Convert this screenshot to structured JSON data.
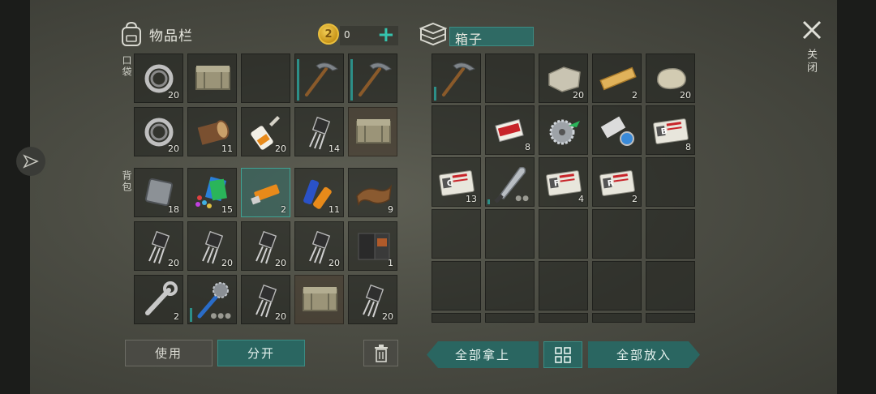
{
  "inventory": {
    "title": "物品栏",
    "coin_icon_label": "2",
    "coins": "0",
    "add_coins": "+",
    "pockets_label": "口袋",
    "backpack_label": "背包"
  },
  "container": {
    "title": "箱子"
  },
  "pocket_slots": [
    {
      "icon": "bearing-icon",
      "count": "20"
    },
    {
      "icon": "crate-icon",
      "count": ""
    },
    {
      "icon": "empty",
      "count": ""
    },
    {
      "icon": "pickaxe-icon",
      "count": "",
      "durability": 0.9
    },
    {
      "icon": "pickaxe-icon",
      "count": "",
      "durability": 0.9
    },
    {
      "icon": "bearing-icon",
      "count": "20"
    },
    {
      "icon": "log-icon",
      "count": "11"
    },
    {
      "icon": "glue-icon",
      "count": "20"
    },
    {
      "icon": "transistor-icon",
      "count": "14"
    },
    {
      "icon": "crate-icon",
      "count": ""
    }
  ],
  "backpack_slots": [
    {
      "icon": "metal-plate-icon",
      "count": "18"
    },
    {
      "icon": "circuit-parts-icon",
      "count": "15"
    },
    {
      "icon": "usb-drive-icon",
      "count": "2",
      "selected": true
    },
    {
      "icon": "batteries-icon",
      "count": "11"
    },
    {
      "icon": "leather-icon",
      "count": "9"
    },
    {
      "icon": "transistor-icon",
      "count": "20"
    },
    {
      "icon": "transistor-icon",
      "count": "20"
    },
    {
      "icon": "transistor-icon",
      "count": "20"
    },
    {
      "icon": "transistor-icon",
      "count": "20"
    },
    {
      "icon": "wallet-icon",
      "count": "1"
    },
    {
      "icon": "wrench-icon",
      "count": "2"
    },
    {
      "icon": "saw-mace-icon",
      "count": "",
      "durability": 0.3,
      "dots": "●●●"
    },
    {
      "icon": "transistor-icon",
      "count": "20"
    },
    {
      "icon": "crate-icon",
      "count": ""
    },
    {
      "icon": "transistor-icon",
      "count": "20"
    }
  ],
  "box_slots": [
    {
      "icon": "pickaxe-icon",
      "count": "",
      "durability": 0.3
    },
    {
      "icon": "empty",
      "count": ""
    },
    {
      "icon": "stone-block-icon",
      "count": "20"
    },
    {
      "icon": "plank-icon",
      "count": "2"
    },
    {
      "icon": "stone-icon",
      "count": "20"
    },
    {
      "icon": "empty",
      "count": ""
    },
    {
      "icon": "cigarettes-icon",
      "count": "8"
    },
    {
      "icon": "saw-blade-icon",
      "count": ""
    },
    {
      "icon": "duct-tape-icon",
      "count": ""
    },
    {
      "icon": "keycard-b-icon",
      "count": "8",
      "letter": "B"
    },
    {
      "icon": "keycard-c-icon",
      "count": "13",
      "letter": "C"
    },
    {
      "icon": "machete-icon",
      "count": "",
      "durability": 0.1,
      "dots": "●●"
    },
    {
      "icon": "keycard-f-icon",
      "count": "4",
      "letter": "F"
    },
    {
      "icon": "keycard-r-icon",
      "count": "2",
      "letter": "R"
    },
    {
      "icon": "empty",
      "count": ""
    }
  ],
  "buttons": {
    "use": "使用",
    "split": "分开",
    "take_all": "全部拿上",
    "put_all": "全部放入"
  },
  "close_label": "关闭",
  "colors": {
    "accent": "#2a6661",
    "accent_border": "#3fa394",
    "plus": "#35c3ad",
    "coin": "#e9be3d"
  }
}
